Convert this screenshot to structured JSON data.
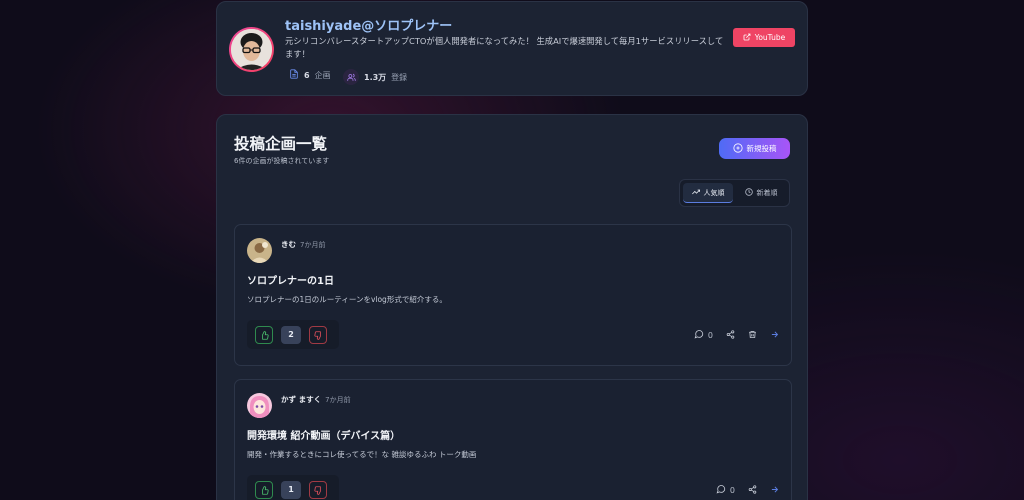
{
  "profile": {
    "name": "taishiyade@ソロプレナー",
    "bio": "元シリコンバレースタートアップCTOが個人開発者になってみた！ 生成AIで爆速開発して毎月1サービスリリースしてます！",
    "projects_count": "6",
    "projects_label": "企画",
    "subscribers_count": "1.3万",
    "subscribers_label": "登録",
    "youtube_label": "YouTube"
  },
  "main": {
    "title": "投稿企画一覧",
    "subtitle": "6件の企画が投稿されています",
    "new_post_label": "新規投稿",
    "sort": {
      "popular": "人気順",
      "newest": "新着順"
    }
  },
  "posts": [
    {
      "author": "きむ",
      "time": "7か月前",
      "title": "ソロプレナーの1日",
      "description": "ソロプレナーの1日のルーティーンをvlog形式で紹介する。",
      "votes": "2",
      "comments": "0"
    },
    {
      "author": "かず ますく",
      "time": "7か月前",
      "title": "開発環境 紹介動画（デバイス篇）",
      "description": "開発・作業するときにコレ使ってるで！な 雑談ゆるふわ トーク動画",
      "votes": "1",
      "comments": "0"
    }
  ],
  "colors": {
    "accent_blue": "#9ec3f7",
    "youtube_red": "#ef4464",
    "new_post_gradient_start": "#4f6bf5",
    "new_post_gradient_end": "#a855f7",
    "upvote_green": "#2f8a4e",
    "downvote_red": "#a03a44"
  },
  "icons": {
    "projects": "document-icon",
    "subscribers": "users-icon",
    "youtube": "external-link-icon",
    "new_post": "plus-circle-icon",
    "popular": "trending-up-icon",
    "newest": "clock-icon",
    "upvote": "thumbs-up-icon",
    "downvote": "thumbs-down-icon",
    "comment": "comment-icon",
    "share": "share-icon",
    "delete": "trash-icon",
    "open": "arrow-right-icon"
  }
}
